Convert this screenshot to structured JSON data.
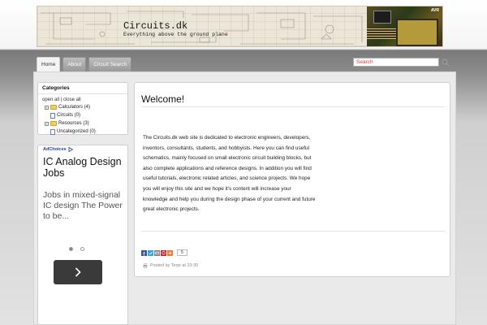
{
  "header": {
    "site_title": "Circuits.dk",
    "tagline": "Everything above the ground plane",
    "photo_logo": "AVR"
  },
  "nav": {
    "tabs": [
      {
        "label": "Home",
        "active": true
      },
      {
        "label": "About",
        "active": false
      },
      {
        "label": "Circuit Search",
        "active": false
      }
    ]
  },
  "search": {
    "placeholder": "Search",
    "icon": "search-icon"
  },
  "sidebar": {
    "categories_title": "Categories",
    "open_all": "open all",
    "separator": "|",
    "close_all": "close all",
    "items": [
      {
        "label": "Calculators (4)",
        "icon": "folder-icon",
        "toggle": "+"
      },
      {
        "label": "Circuits (0)",
        "icon": "document-icon",
        "toggle": ""
      },
      {
        "label": "Resources (3)",
        "icon": "folder-icon",
        "toggle": "+"
      },
      {
        "label": "Uncategorized (0)",
        "icon": "document-icon",
        "toggle": ""
      }
    ]
  },
  "ad": {
    "choices_label": "AdChoices",
    "title": "IC Analog Design Jobs",
    "text": "Jobs in mixed-signal IC design The Power to be...",
    "button_icon": "chevron-right-icon",
    "pager_count": 2,
    "pager_active": 0
  },
  "post": {
    "title": "Welcome!",
    "body": "The Circuits.dk web site is dedicated to electronic engineers, developers, inventors, consultants, students, and hobbyists. Here you can find useful schematics, mainly focused on small electronic circuit building blocks, but also complete applications and reference designs. In addition you will find useful tutorials, electronic related articles, and science projects. We hope you will enjoy this site and we hope it's content will increase your knowledge and help you during the design phase of your current and future great electronic projects.",
    "share_icons": [
      "facebook-icon",
      "twitter-icon",
      "email-icon",
      "pinterest-icon",
      "plus-icon"
    ],
    "share_count": "5",
    "meta": "Posted by Terje at 23:30"
  },
  "colors": {
    "facebook": "#3b5998",
    "twitter": "#2ea7e0",
    "email": "#7a7a7a",
    "pinterest": "#cb2027",
    "plus": "#f07a2a",
    "search_text": "#dd3333"
  }
}
